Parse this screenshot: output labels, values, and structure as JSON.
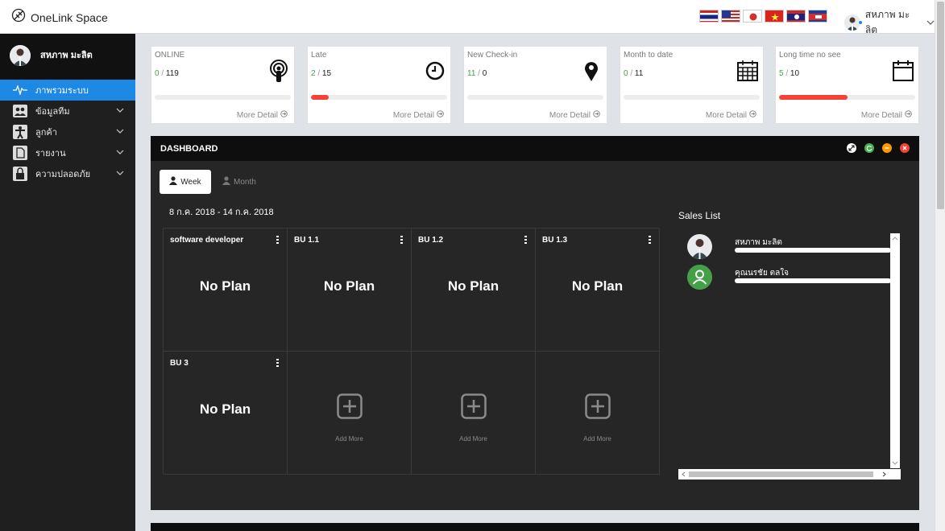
{
  "app": {
    "name": "OneLink Space"
  },
  "header": {
    "flags": [
      "th-flag-icon",
      "us-flag-icon",
      "jp-flag-icon",
      "vn-flag-icon",
      "la-flag-icon",
      "kh-flag-icon"
    ],
    "user_name": "สหภาพ มะลิต"
  },
  "sidebar": {
    "user_name": "สหภาพ มะลิต",
    "items": [
      {
        "label": "ภาพรวมระบบ",
        "icon": "pulse-icon",
        "active": true
      },
      {
        "label": "ข้อมูลทีม",
        "icon": "team-icon"
      },
      {
        "label": "ลูกค้า",
        "icon": "person-icon"
      },
      {
        "label": "รายงาน",
        "icon": "document-icon"
      },
      {
        "label": "ความปลอดภัย",
        "icon": "lock-icon"
      }
    ]
  },
  "stats": [
    {
      "title": "ONLINE",
      "current": "0",
      "total": "119",
      "icon": "broadcast-icon",
      "progress": 0,
      "more": "More Detail"
    },
    {
      "title": "Late",
      "current": "2",
      "total": "15",
      "icon": "clock-icon",
      "progress": 0.13,
      "more": "More Detail"
    },
    {
      "title": "New Check-in",
      "current": "11",
      "total": "0",
      "icon": "map-pin-icon",
      "progress": 0,
      "more": "More Detail"
    },
    {
      "title": "Month to date",
      "current": "0",
      "total": "11",
      "icon": "calendar-grid-icon",
      "progress": 0,
      "more": "More Detail"
    },
    {
      "title": "Long time no see",
      "current": "5",
      "total": "10",
      "icon": "calendar-icon",
      "progress": 0.5,
      "more": "More Detail"
    }
  ],
  "dashboard": {
    "title": "DASHBOARD",
    "tabs": {
      "week": "Week",
      "month": "Month"
    },
    "date_range": "8 ก.ค. 2018 - 14 ก.ค. 2018",
    "cells": [
      {
        "title": "software developer",
        "status": "No Plan"
      },
      {
        "title": "BU 1.1",
        "status": "No Plan"
      },
      {
        "title": "BU 1.2",
        "status": "No Plan"
      },
      {
        "title": "BU 1.3",
        "status": "No Plan"
      },
      {
        "title": "BU 3",
        "status": "No Plan"
      }
    ],
    "add_more": "Add More",
    "sales_title": "Sales List",
    "sales": [
      {
        "name": "สหภาพ มะลิต"
      },
      {
        "name": "คุณนรชัย ตลใจ"
      }
    ]
  },
  "colors": {
    "accent": "#1e88e5",
    "green": "#43a047",
    "red": "#f44336",
    "orange": "#ff9800"
  }
}
